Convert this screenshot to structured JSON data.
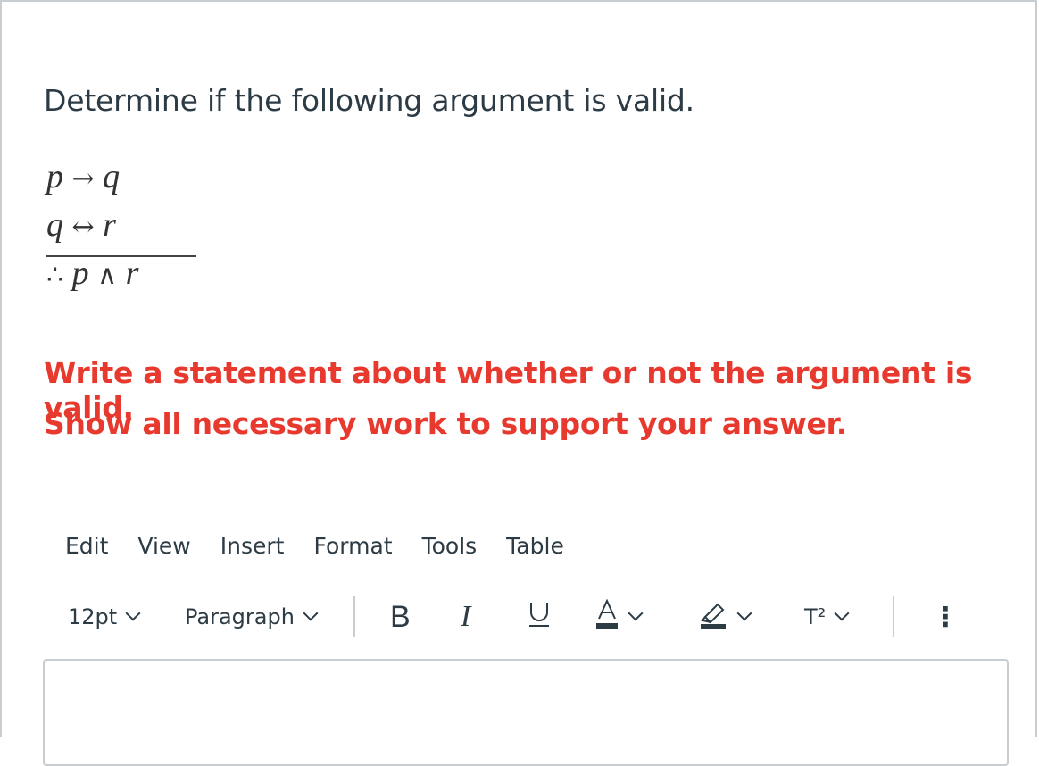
{
  "question": {
    "prompt": "Determine if the following argument is valid.",
    "premise1": {
      "left": "p",
      "op": "→",
      "right": "q"
    },
    "premise2": {
      "left": "q",
      "op": "↔",
      "right": "r"
    },
    "conclusion": {
      "therefore": "∴",
      "left": "p",
      "op": "∧",
      "right": "r"
    }
  },
  "instructions": {
    "line1": "Write a statement about whether or not the argument is valid.",
    "line2": "Show all necessary work to support your answer.",
    "color": "#e8392f"
  },
  "menubar": {
    "items": [
      "Edit",
      "View",
      "Insert",
      "Format",
      "Tools",
      "Table"
    ]
  },
  "toolbar": {
    "font_size": "12pt",
    "block_format": "Paragraph",
    "bold_label": "B",
    "italic_label": "I",
    "underline_label": "U",
    "text_color_label": "A",
    "superscript_label": "T²",
    "more_label": "⋮"
  },
  "editor": {
    "value": ""
  }
}
